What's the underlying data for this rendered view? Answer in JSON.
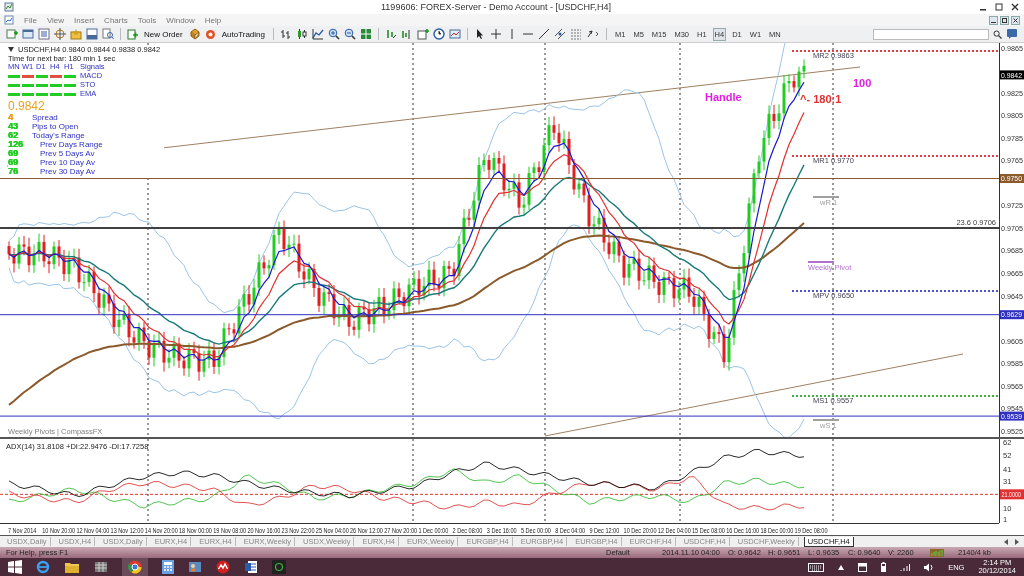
{
  "window": {
    "title": "1199606: FOREX-Server - Demo Account - [USDCHF,H4]"
  },
  "menu": [
    "File",
    "View",
    "Insert",
    "Charts",
    "Tools",
    "Window",
    "Help"
  ],
  "toolbar": {
    "buttons": [
      "New Order",
      "AutoTrading"
    ],
    "timeframes": [
      {
        "label": "M1",
        "selected": false
      },
      {
        "label": "M5",
        "selected": false
      },
      {
        "label": "M15",
        "selected": false
      },
      {
        "label": "M30",
        "selected": false
      },
      {
        "label": "H1",
        "selected": false
      },
      {
        "label": "H4",
        "selected": true
      },
      {
        "label": "D1",
        "selected": false
      },
      {
        "label": "W1",
        "selected": false
      },
      {
        "label": "MN",
        "selected": false
      }
    ]
  },
  "chart": {
    "header": "USDCHF,H4  0.9840 0.9844 0.9838 0.9842",
    "timer": "Time for next bar: 180 min 1 sec",
    "signals": {
      "columns": [
        "MN",
        "W1",
        "D1",
        "H4",
        "H1"
      ],
      "title": "Signals",
      "rows": [
        {
          "name": "MACD",
          "cells": [
            {
              "color": "#22cc22"
            },
            {
              "color": "#e0503c"
            },
            {
              "color": "#22cc22"
            },
            {
              "color": "#e0503c"
            },
            {
              "color": "#22cc22"
            }
          ]
        },
        {
          "name": "STO",
          "cells": [
            {
              "color": "#22cc22"
            },
            {
              "color": "#22cc22"
            },
            {
              "color": "#22cc22"
            },
            {
              "color": "#22cc22"
            },
            {
              "color": "#22cc22"
            }
          ]
        },
        {
          "name": "EMA",
          "cells": [
            {
              "color": "#22cc22"
            },
            {
              "color": "#22cc22"
            },
            {
              "color": "#22cc22"
            },
            {
              "color": "#22cc22"
            },
            {
              "color": "#22cc22"
            }
          ]
        }
      ]
    },
    "price": "0.9842",
    "stats": [
      {
        "value": "4",
        "label": "Spread",
        "kind": "today",
        "color": "#f0a020"
      },
      {
        "value": "43",
        "label": "Pips to Open",
        "kind": "today",
        "color": "#22cc22"
      },
      {
        "value": "62",
        "label": "Today's Range",
        "kind": "today",
        "color": "#22cc22"
      },
      {
        "value": "126",
        "label": "Prev Days Range",
        "kind": "previous",
        "color": "#22cc22"
      },
      {
        "value": "69",
        "label": "Prev 5 Days Av",
        "kind": "previous",
        "color": "#22cc22"
      },
      {
        "value": "69",
        "label": "Prev 10 Day Av",
        "kind": "previous",
        "color": "#22cc22"
      },
      {
        "value": "76",
        "label": "Prev 30 Day Av",
        "kind": "previous",
        "color": "#22cc22"
      }
    ],
    "price_scale": [
      "0.9865",
      "0.9825",
      "0.9805",
      "0.9785",
      "0.9765",
      "0.9725",
      "0.9705",
      "0.9685",
      "0.9665",
      "0.9645",
      "0.9605",
      "0.9585",
      "0.9565",
      "0.9545",
      "0.9525"
    ],
    "price_markers": [
      {
        "text": "0.9842",
        "kind": "current",
        "color": "#000000"
      },
      {
        "text": "0.9750",
        "kind": "level",
        "color": "#8b5a2b"
      },
      {
        "text": "0.9629",
        "kind": "level",
        "color": "#3030c0"
      },
      {
        "text": "0.9539",
        "kind": "level",
        "color": "#3030c0"
      }
    ],
    "notes": [
      {
        "text": "MR2  0.9863",
        "kind": "pivot",
        "color": "#e04040"
      },
      {
        "text": "MR1  0.9770",
        "kind": "pivot",
        "color": "#e04040"
      },
      {
        "text": "MPV  0.9650",
        "kind": "pivot",
        "color": "#5050c8"
      },
      {
        "text": "MS1  0.9557",
        "kind": "pivot",
        "color": "#40b040"
      },
      {
        "text": "wR 1",
        "kind": "weekly",
        "color": "#a0a0a0"
      },
      {
        "text": "Weekly Pivot",
        "kind": "weekly",
        "color": "#b070d0"
      },
      {
        "text": "wS 1",
        "kind": "weekly",
        "color": "#a0a0a0"
      },
      {
        "text": "23.6  0.9706",
        "kind": "fib",
        "color": "#404040"
      },
      {
        "text": "Handle",
        "kind": "note",
        "color": "#e020e0"
      },
      {
        "text": "100",
        "kind": "note",
        "color": "#e020e0"
      },
      {
        "text": "^- 180:1",
        "kind": "note",
        "color": "#e03030"
      },
      {
        "text": "Weekly Pivots | CompassFX",
        "kind": "caption"
      }
    ],
    "indicator": {
      "title": "ADX(14) 31.8108 +DI:22.9476 -DI:17.7258",
      "scale": [
        "62",
        "52",
        "41",
        "31",
        "10",
        "1"
      ],
      "marker": {
        "text": "21.0000",
        "color": "#e03030"
      }
    },
    "time_scale": [
      "7 Nov 2014",
      "10 Nov 20:00",
      "12 Nov 04:00",
      "13 Nov 12:00",
      "14 Nov 20:00",
      "18 Nov 00:00",
      "19 Nov 08:00",
      "20 Nov 16:00",
      "23 Nov 22:00",
      "25 Nov 04:00",
      "26 Nov 12:00",
      "27 Nov 20:00",
      "1 Dec 00:00",
      "2 Dec 08:00",
      "3 Dec 16:00",
      "5 Dec 00:00",
      "8 Dec 04:00",
      "9 Dec 12:00",
      "10 Dec 20:00",
      "12 Dec 04:00",
      "15 Dec 08:00",
      "16 Dec 16:00",
      "18 Dec 00:00",
      "19 Dec 08:00"
    ]
  },
  "tabs": [
    {
      "label": "USDX,Daily",
      "selected": false
    },
    {
      "label": "USDX,H4",
      "selected": false
    },
    {
      "label": "USDX,Daily",
      "selected": false
    },
    {
      "label": "EURX,H4",
      "selected": false
    },
    {
      "label": "EURX,H4",
      "selected": false
    },
    {
      "label": "EURX,Weekly",
      "selected": false
    },
    {
      "label": "USDX,Weekly",
      "selected": false
    },
    {
      "label": "EURX,H4",
      "selected": false
    },
    {
      "label": "EURX,Weekly",
      "selected": false
    },
    {
      "label": "EURGBP,H4",
      "selected": false
    },
    {
      "label": "EURGBP,H4",
      "selected": false
    },
    {
      "label": "EURGBP,H4",
      "selected": false
    },
    {
      "label": "EURCHF,H4",
      "selected": false
    },
    {
      "label": "USDCHF,H4",
      "selected": false
    },
    {
      "label": "USDCHF,Weekly",
      "selected": false
    },
    {
      "label": "USDCHF,H4",
      "selected": true
    }
  ],
  "status_bar": {
    "help": "For Help, press F1",
    "profile": "Default",
    "fields": [
      "2014.11.10 04:00",
      "O: 0.9642",
      "H: 0.9651",
      "L: 0.9635",
      "C: 0.9640",
      "V: 2260"
    ],
    "traffic": "2140/4 kb"
  },
  "taskbar": {
    "language": "ENG",
    "time": "2:14 PM",
    "date": "20/12/2014"
  }
}
